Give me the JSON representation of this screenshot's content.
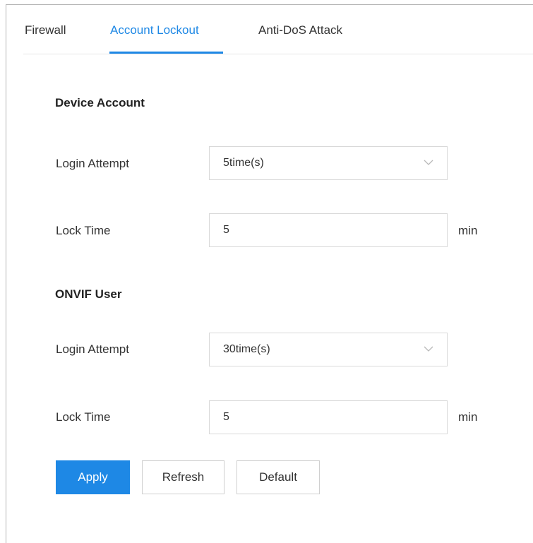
{
  "tabs": [
    {
      "label": "Firewall",
      "active": false
    },
    {
      "label": "Account Lockout",
      "active": true
    },
    {
      "label": "Anti-DoS Attack",
      "active": false
    }
  ],
  "sections": {
    "device_account": {
      "title": "Device Account",
      "login_attempt_label": "Login Attempt",
      "login_attempt_value": "5time(s)",
      "lock_time_label": "Lock Time",
      "lock_time_value": "5",
      "lock_time_unit": "min"
    },
    "onvif_user": {
      "title": "ONVIF User",
      "login_attempt_label": "Login Attempt",
      "login_attempt_value": "30time(s)",
      "lock_time_label": "Lock Time",
      "lock_time_value": "5",
      "lock_time_unit": "min"
    }
  },
  "buttons": {
    "apply": "Apply",
    "refresh": "Refresh",
    "default": "Default"
  },
  "colors": {
    "accent": "#1e88e5",
    "border": "#d9d9d9"
  },
  "icons": {
    "dropdown": "chevron-down-icon"
  }
}
